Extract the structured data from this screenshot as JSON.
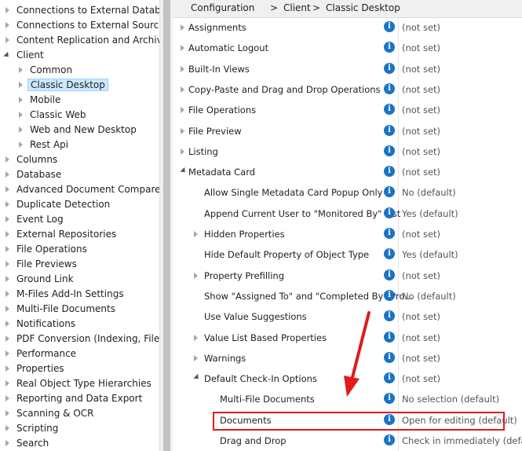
{
  "tree": [
    {
      "label": "Connections to External Database",
      "level": 1,
      "state": "collapsed"
    },
    {
      "label": "Connections to External Sources",
      "level": 1,
      "state": "collapsed"
    },
    {
      "label": "Content Replication and Archiving",
      "level": 1,
      "state": "collapsed"
    },
    {
      "label": "Client",
      "level": 1,
      "state": "expanded"
    },
    {
      "label": "Common",
      "level": 2,
      "state": "collapsed"
    },
    {
      "label": "Classic Desktop",
      "level": 2,
      "state": "collapsed",
      "selected": true
    },
    {
      "label": "Mobile",
      "level": 2,
      "state": "collapsed"
    },
    {
      "label": "Classic Web",
      "level": 2,
      "state": "collapsed"
    },
    {
      "label": "Web and New Desktop",
      "level": 2,
      "state": "collapsed"
    },
    {
      "label": "Rest Api",
      "level": 2,
      "state": "collapsed"
    },
    {
      "label": "Columns",
      "level": 1,
      "state": "collapsed"
    },
    {
      "label": "Database",
      "level": 1,
      "state": "collapsed"
    },
    {
      "label": "Advanced Document Compare",
      "level": 1,
      "state": "collapsed"
    },
    {
      "label": "Duplicate Detection",
      "level": 1,
      "state": "collapsed"
    },
    {
      "label": "Event Log",
      "level": 1,
      "state": "collapsed"
    },
    {
      "label": "External Repositories",
      "level": 1,
      "state": "collapsed"
    },
    {
      "label": "File Operations",
      "level": 1,
      "state": "collapsed"
    },
    {
      "label": "File Previews",
      "level": 1,
      "state": "collapsed"
    },
    {
      "label": "Ground Link",
      "level": 1,
      "state": "collapsed"
    },
    {
      "label": "M-Files Add-In Settings",
      "level": 1,
      "state": "collapsed"
    },
    {
      "label": "Multi-File Documents",
      "level": 1,
      "state": "collapsed"
    },
    {
      "label": "Notifications",
      "level": 1,
      "state": "collapsed"
    },
    {
      "label": "PDF Conversion (Indexing, File Pre",
      "level": 1,
      "state": "collapsed"
    },
    {
      "label": "Performance",
      "level": 1,
      "state": "collapsed"
    },
    {
      "label": "Properties",
      "level": 1,
      "state": "collapsed"
    },
    {
      "label": "Real Object Type Hierarchies",
      "level": 1,
      "state": "collapsed"
    },
    {
      "label": "Reporting and Data Export",
      "level": 1,
      "state": "collapsed"
    },
    {
      "label": "Scanning & OCR",
      "level": 1,
      "state": "collapsed"
    },
    {
      "label": "Scripting",
      "level": 1,
      "state": "collapsed"
    },
    {
      "label": "Search",
      "level": 1,
      "state": "collapsed"
    }
  ],
  "breadcrumb": {
    "a": "Configuration",
    "sep1": ">",
    "b": "Client",
    "sep2": ">",
    "c": "Classic Desktop"
  },
  "settings": [
    {
      "label": "Assignments",
      "level": 1,
      "state": "collapsed",
      "value": "(not set)"
    },
    {
      "label": "Automatic Logout",
      "level": 1,
      "state": "collapsed",
      "value": "(not set)"
    },
    {
      "label": "Built-In Views",
      "level": 1,
      "state": "collapsed",
      "value": "(not set)"
    },
    {
      "label": "Copy-Paste and Drag and Drop Operations",
      "level": 1,
      "state": "collapsed",
      "value": "(not set)"
    },
    {
      "label": "File Operations",
      "level": 1,
      "state": "collapsed",
      "value": "(not set)"
    },
    {
      "label": "File Preview",
      "level": 1,
      "state": "collapsed",
      "value": "(not set)"
    },
    {
      "label": "Listing",
      "level": 1,
      "state": "collapsed",
      "value": "(not set)"
    },
    {
      "label": "Metadata Card",
      "level": 1,
      "state": "expanded",
      "value": "(not set)"
    },
    {
      "label": "Allow Single Metadata Card Popup Only",
      "level": 2,
      "state": "leaf",
      "value": "No (default)"
    },
    {
      "label": "Append Current User to \"Monitored By\" List",
      "level": 2,
      "state": "leaf",
      "value": "Yes (default)"
    },
    {
      "label": "Hidden Properties",
      "level": 2,
      "state": "collapsed",
      "value": "(not set)"
    },
    {
      "label": "Hide Default Property of Object Type",
      "level": 2,
      "state": "leaf",
      "value": "Yes (default)"
    },
    {
      "label": "Property Prefilling",
      "level": 2,
      "state": "collapsed",
      "value": "(not set)"
    },
    {
      "label": "Show \"Assigned To\" and \"Completed By\" Pro...",
      "level": 2,
      "state": "leaf",
      "value": "No (default)"
    },
    {
      "label": "Use Value Suggestions",
      "level": 2,
      "state": "leaf",
      "value": "(not set)"
    },
    {
      "label": "Value List Based Properties",
      "level": 2,
      "state": "collapsed",
      "value": "(not set)"
    },
    {
      "label": "Warnings",
      "level": 2,
      "state": "collapsed",
      "value": "(not set)"
    },
    {
      "label": "Default Check-In Options",
      "level": 2,
      "state": "expanded",
      "value": "(not set)"
    },
    {
      "label": "Multi-File Documents",
      "level": 3,
      "state": "leaf",
      "value": "No selection (default)"
    },
    {
      "label": "Documents",
      "level": 3,
      "state": "leaf",
      "value": "Open for editing (default)",
      "highlighted": true
    },
    {
      "label": "Drag and Drop",
      "level": 3,
      "state": "leaf",
      "value": "Check in immediately (default)"
    }
  ],
  "info_glyph": "i",
  "icons": {
    "expand": "triangle-right-icon",
    "collapse": "triangle-down-icon",
    "info": "info-icon",
    "annotation": "red-arrow"
  },
  "colors": {
    "selection": "#cce8ff",
    "info": "#1a73c8",
    "annotation": "#e11b1b"
  }
}
